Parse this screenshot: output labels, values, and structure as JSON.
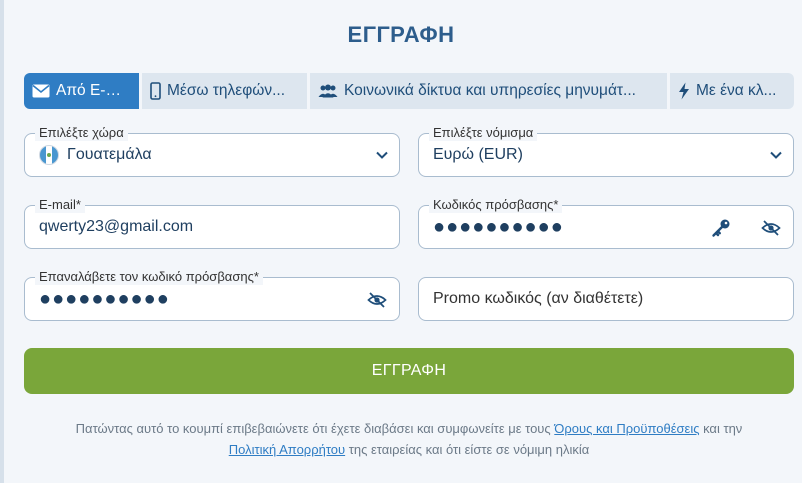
{
  "title": "ΕΓΓΡΑΦΗ",
  "tabs": [
    {
      "label": "Από E-m...",
      "icon": "envelope-icon",
      "active": true
    },
    {
      "label": "Μέσω τηλεφών...",
      "icon": "phone-icon"
    },
    {
      "label": "Κοινωνικά δίκτυα και υπηρεσίες μηνυμάτ...",
      "icon": "users-icon"
    },
    {
      "label": "Με ένα κλ...",
      "icon": "lightning-icon"
    }
  ],
  "country": {
    "label": "Επιλέξτε χώρα",
    "value": "Γουατεμάλα"
  },
  "currency": {
    "label": "Επιλέξτε νόμισμα",
    "value": "Ευρώ (EUR)"
  },
  "email": {
    "label": "E-mail*",
    "value": "qwerty23@gmail.com"
  },
  "password": {
    "label": "Κωδικός πρόσβασης*",
    "value": "●●●●●●●●●●"
  },
  "confirm_password": {
    "label": "Επαναλάβετε τον κωδικό πρόσβασης*",
    "value": "●●●●●●●●●●"
  },
  "promo": {
    "placeholder": "Promo κωδικός (αν διαθέτετε)"
  },
  "submit_label": "ΕΓΓΡΑΦΗ",
  "legal": {
    "text1": "Πατώντας αυτό το κουμπί επιβεβαιώνετε ότι έχετε διαβάσει και συμφωνείτε με τους ",
    "link1": "Όρους και Προϋποθέσεις",
    "text2": " και την ",
    "link2": "Πολιτική Απορρήτου",
    "text3": " της εταιρείας και ότι είστε σε νόμιμη ηλικία"
  },
  "colors": {
    "accent": "#2f7dc4",
    "submit": "#7aa63a",
    "title": "#2d5d8c"
  }
}
